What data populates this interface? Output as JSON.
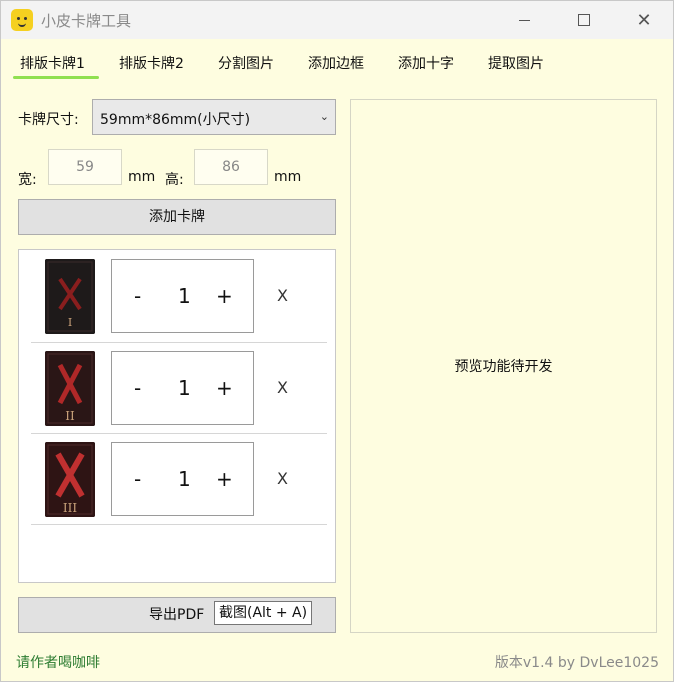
{
  "window": {
    "title": "小皮卡牌工具"
  },
  "tabs": [
    {
      "label": "排版卡牌1",
      "active": true
    },
    {
      "label": "排版卡牌2"
    },
    {
      "label": "分割图片"
    },
    {
      "label": "添加边框"
    },
    {
      "label": "添加十字"
    },
    {
      "label": "提取图片"
    }
  ],
  "card_size": {
    "label": "卡牌尺寸:",
    "selected": "59mm*86mm(小尺寸)"
  },
  "dimensions": {
    "width_label": "宽:",
    "width_value": "59",
    "height_label": "高:",
    "height_value": "86",
    "unit": "mm"
  },
  "add_card_label": "添加卡牌",
  "cards": [
    {
      "numeral": "I",
      "count": "1",
      "minus": "-",
      "plus": "+",
      "remove": "X"
    },
    {
      "numeral": "II",
      "count": "1",
      "minus": "-",
      "plus": "+",
      "remove": "X"
    },
    {
      "numeral": "III",
      "count": "1",
      "minus": "-",
      "plus": "+",
      "remove": "X"
    }
  ],
  "export_label": "导出PDF",
  "tooltip": "截图(Alt + A)",
  "preview_text": "预览功能待开发",
  "footer": {
    "coffee": "请作者喝咖啡",
    "version": "版本v1.4 by DvLee1025"
  },
  "colors": {
    "background": "#fefde0",
    "tab_underline": "#90e050",
    "coffee_link": "#2e7d32"
  }
}
